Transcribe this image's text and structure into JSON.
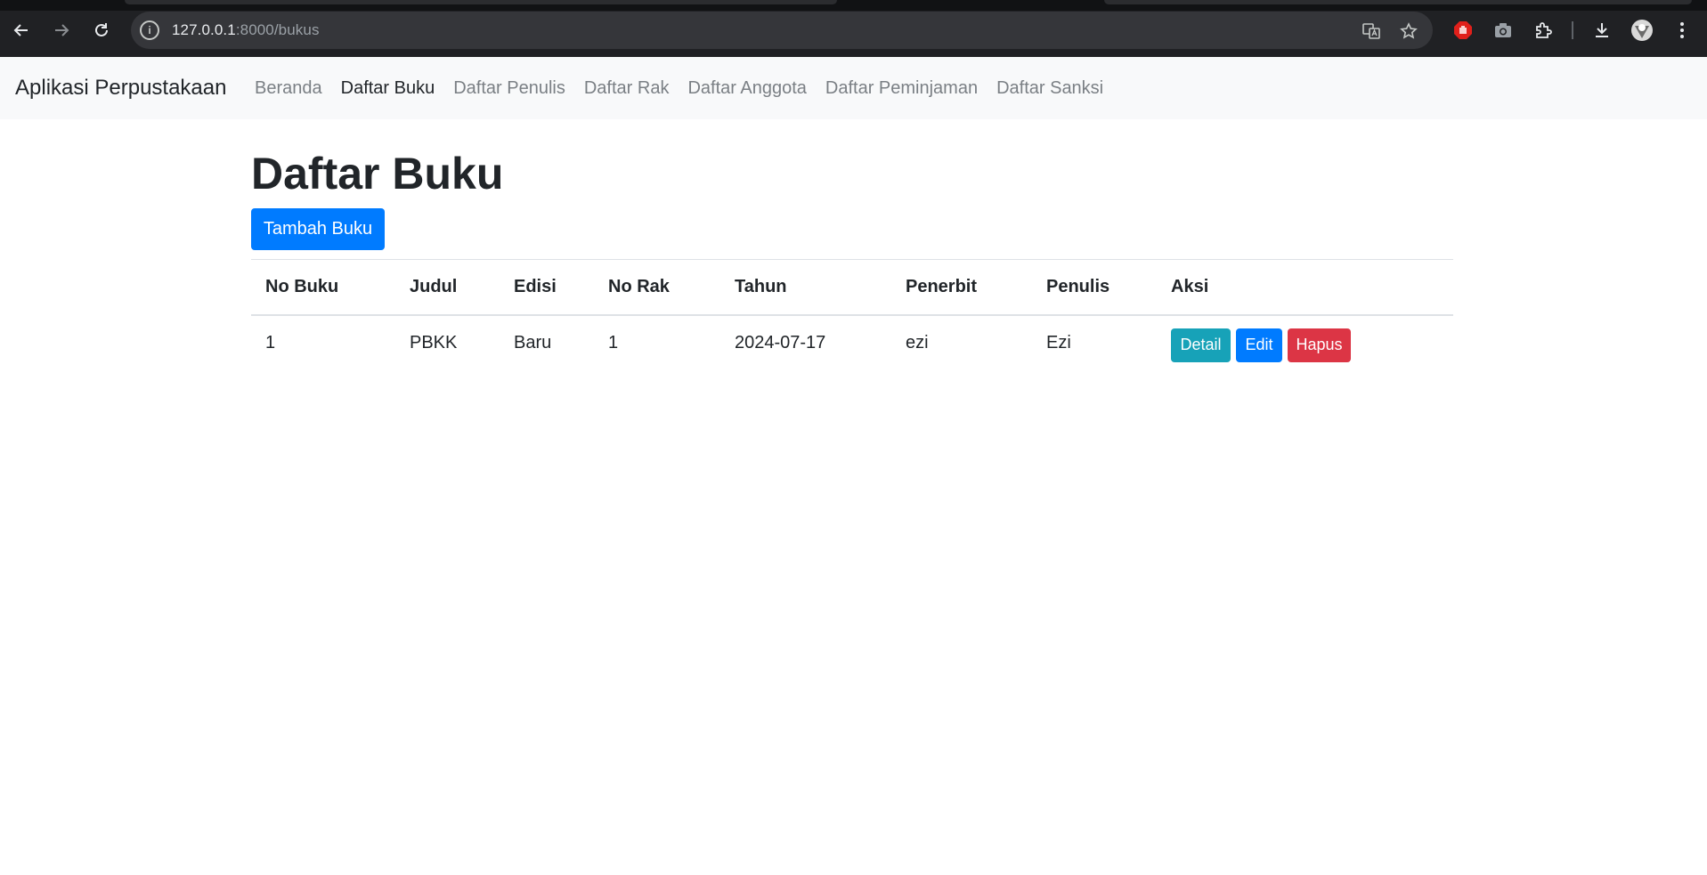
{
  "browser": {
    "url_host": "127.0.0.1",
    "url_rest": ":8000/bukus"
  },
  "navbar": {
    "brand": "Aplikasi Perpustakaan",
    "links": [
      {
        "label": "Beranda",
        "active": false
      },
      {
        "label": "Daftar Buku",
        "active": true
      },
      {
        "label": "Daftar Penulis",
        "active": false
      },
      {
        "label": "Daftar Rak",
        "active": false
      },
      {
        "label": "Daftar Anggota",
        "active": false
      },
      {
        "label": "Daftar Peminjaman",
        "active": false
      },
      {
        "label": "Daftar Sanksi",
        "active": false
      }
    ]
  },
  "page": {
    "title": "Daftar Buku",
    "add_button": "Tambah Buku"
  },
  "table": {
    "headers": [
      "No Buku",
      "Judul",
      "Edisi",
      "No Rak",
      "Tahun",
      "Penerbit",
      "Penulis",
      "Aksi"
    ],
    "rows": [
      {
        "cells": [
          "1",
          "PBKK",
          "Baru",
          "1",
          "2024-07-17",
          "ezi",
          "Ezi"
        ],
        "actions": {
          "detail": "Detail",
          "edit": "Edit",
          "delete": "Hapus"
        }
      }
    ]
  },
  "colors": {
    "primary": "#007bff",
    "info": "#17a2b8",
    "danger": "#dc3545",
    "navbar_bg": "#f8f9fa"
  }
}
